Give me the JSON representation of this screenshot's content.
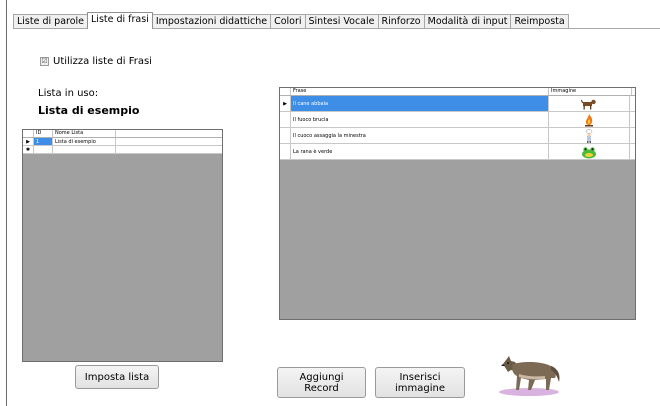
{
  "tabs": [
    {
      "label": "Liste di  parole",
      "active": false
    },
    {
      "label": "Liste di frasi",
      "active": true
    },
    {
      "label": "Impostazioni didattiche",
      "active": false
    },
    {
      "label": "Colori",
      "active": false
    },
    {
      "label": "Sintesi Vocale",
      "active": false
    },
    {
      "label": "Rinforzo",
      "active": false
    },
    {
      "label": "Modalità di input",
      "active": false
    },
    {
      "label": "Reimposta",
      "active": false
    }
  ],
  "use_lists": {
    "label": "Utilizza liste di Frasi",
    "checked": true,
    "mark": "☑"
  },
  "list_in_use": {
    "label": "Lista in uso:",
    "value": "Lista di esempio"
  },
  "lists_grid": {
    "headers": {
      "id": "ID",
      "name": "Nome Lista"
    },
    "rows": [
      {
        "indicator": "▶",
        "id": "1",
        "name": "Lista di esempio"
      },
      {
        "indicator": "✱",
        "id": "",
        "name": ""
      }
    ]
  },
  "phrases_grid": {
    "headers": {
      "phrase": "Frase",
      "image": "Immagine"
    },
    "rows": [
      {
        "indicator": "▶",
        "phrase": "Il cane abbaia",
        "image": "dog-icon"
      },
      {
        "indicator": "",
        "phrase": "Il fuoco brucia",
        "image": "fire-icon"
      },
      {
        "indicator": "",
        "phrase": "Il cuoco assaggia la minestra",
        "image": "cook-icon"
      },
      {
        "indicator": "",
        "phrase": "La rana è verde",
        "image": "frog-icon"
      }
    ]
  },
  "buttons": {
    "set_list": "Imposta lista",
    "add_record": "Aggiungi Record",
    "insert_image": "Inserisci immagine"
  },
  "preview_image": "wolf-icon",
  "colors": {
    "selection": "#3e8ee8",
    "grid_empty": "#a0a0a0"
  }
}
